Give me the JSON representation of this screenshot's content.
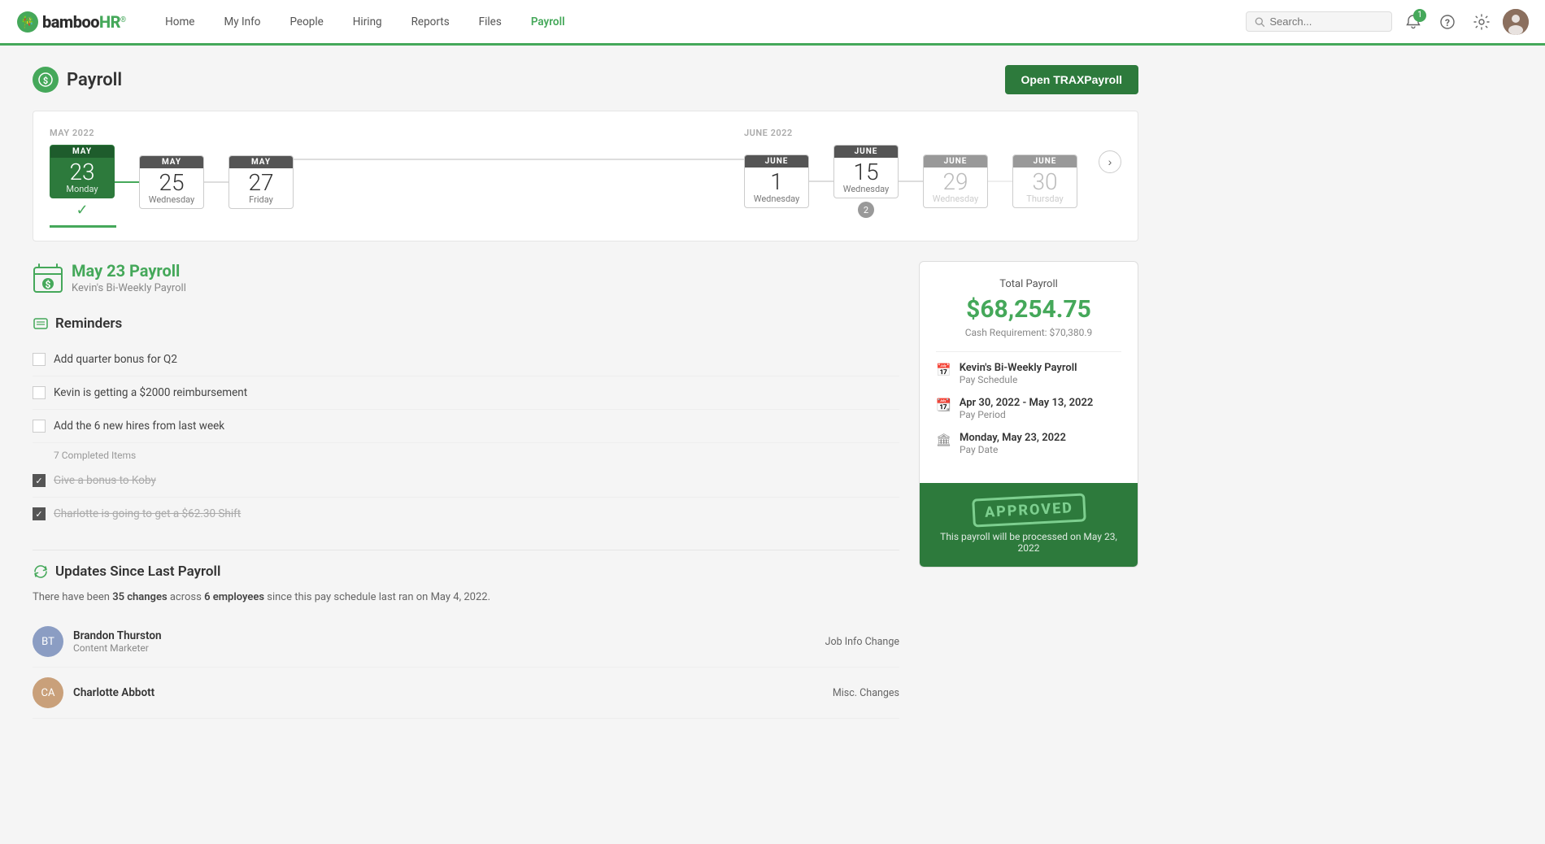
{
  "app": {
    "logo": "bamboo",
    "logo_hr": "HR",
    "logo_reg": "®"
  },
  "nav": {
    "links": [
      {
        "id": "home",
        "label": "Home",
        "active": false
      },
      {
        "id": "my-info",
        "label": "My Info",
        "active": false
      },
      {
        "id": "people",
        "label": "People",
        "active": false
      },
      {
        "id": "hiring",
        "label": "Hiring",
        "active": false
      },
      {
        "id": "reports",
        "label": "Reports",
        "active": false
      },
      {
        "id": "files",
        "label": "Files",
        "active": false
      },
      {
        "id": "payroll",
        "label": "Payroll",
        "active": true
      }
    ],
    "search_placeholder": "Search...",
    "notification_count": "1"
  },
  "page": {
    "title": "Payroll",
    "open_trax_label": "Open TRAXPayroll"
  },
  "timeline": {
    "group1_label": "MAY 2022",
    "group2_label": "JUNE 2022",
    "items": [
      {
        "month": "MAY",
        "day": "23",
        "weekday": "Monday",
        "active": true,
        "gray": false
      },
      {
        "month": "MAY",
        "day": "25",
        "weekday": "Wednesday",
        "active": false,
        "gray": false
      },
      {
        "month": "MAY",
        "day": "27",
        "weekday": "Friday",
        "active": false,
        "gray": false
      },
      {
        "month": "JUNE",
        "day": "1",
        "weekday": "Wednesday",
        "active": false,
        "gray": false
      },
      {
        "month": "JUNE",
        "day": "15",
        "weekday": "Wednesday",
        "active": false,
        "gray": false,
        "badge": "2"
      },
      {
        "month": "JUNE",
        "day": "29",
        "weekday": "Wednesday",
        "active": false,
        "gray": true
      },
      {
        "month": "JUNE",
        "day": "30",
        "weekday": "Thursday",
        "active": false,
        "gray": true
      }
    ],
    "nav_next": "›"
  },
  "payroll_detail": {
    "title": "May 23 Payroll",
    "subtitle": "Kevin's Bi-Weekly Payroll"
  },
  "reminders": {
    "section_title": "Reminders",
    "items": [
      {
        "text": "Add quarter bonus for Q2",
        "checked": false
      },
      {
        "text": "Kevin is getting a $2000 reimbursement",
        "checked": false
      },
      {
        "text": "Add the 6 new hires from last week",
        "checked": false
      }
    ],
    "completed_label": "7 Completed Items",
    "completed_items": [
      {
        "text": "Give a bonus to Koby",
        "checked": true
      },
      {
        "text": "Charlotte is going to get a $62.30 Shift",
        "checked": true
      }
    ]
  },
  "updates": {
    "section_title": "Updates Since Last Payroll",
    "description_prefix": "There have been ",
    "changes_count": "35 changes",
    "description_middle": " across ",
    "employees_count": "6 employees",
    "description_suffix": " since this pay schedule last ran on May 4, 2022.",
    "employees": [
      {
        "name": "Brandon Thurston",
        "role": "Content Marketer",
        "change_type": "Job Info Change",
        "initials": "BT",
        "bg": "#8b9dc3"
      },
      {
        "name": "Charlotte Abbott",
        "role": "",
        "change_type": "Misc. Changes",
        "initials": "CA",
        "bg": "#c9a07a"
      }
    ]
  },
  "payroll_card": {
    "total_label": "Total Payroll",
    "total_amount": "$68,254.75",
    "cash_req_label": "Cash Requirement: $70,380.9",
    "schedule_icon": "📅",
    "schedule_label": "Kevin's Bi-Weekly Payroll",
    "schedule_sub": "Pay Schedule",
    "period_icon": "📆",
    "period_label": "Apr 30, 2022 - May 13, 2022",
    "period_sub": "Pay Period",
    "date_icon": "🏛",
    "date_label": "Monday, May 23, 2022",
    "date_sub": "Pay Date",
    "approved_label": "APPROVED",
    "processed_label": "This payroll will be processed on May 23, 2022"
  }
}
